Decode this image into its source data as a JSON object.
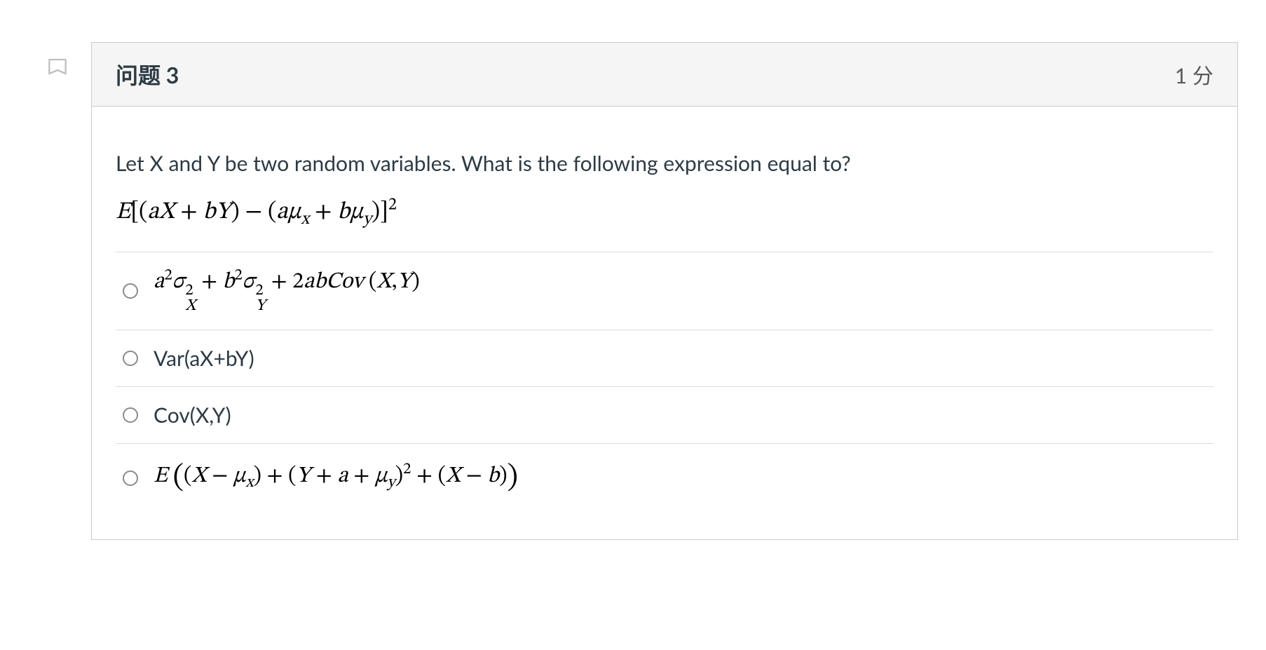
{
  "question": {
    "title": "问题 3",
    "points": "1 分",
    "prompt": "Let X and Y be two random variables. What is the following expression equal to?",
    "expression_html": "<span class='m'>E</span><span class='rm'>[(</span><span class='m'>aX</span> <span class='rm'>+</span> <span class='m'>bY</span><span class='rm'>)</span> <span class='rm'>−</span> <span class='rm'>(</span><span class='m'>aμ</span><sub class='m'>x</sub> <span class='rm'>+</span> <span class='m'>bμ</span><sub class='m'>y</sub><span class='rm'>)]</span><sup>2</sup>",
    "answers": [
      {
        "id": "a",
        "is_math": true,
        "html": "<span class='m'>a</span><sup>2</sup><span class='m'>σ</span><span class='subsup'><span class='sup'>2</span><span class='sub m'>X</span></span> <span class='rm'>+</span> <span class='m'>b</span><sup>2</sup><span class='m'>σ</span><span class='subsup'><span class='sup'>2</span><span class='sub m'>Y</span></span> <span class='rm'>+</span> <span class='rm'>2</span><span class='m'>abCov</span> <span class='rm'>(</span><span class='m'>X</span><span class='rm'>,</span><span class='m'>Y</span><span class='rm'>)</span>"
      },
      {
        "id": "b",
        "is_math": false,
        "html": "Var(aX+bY)"
      },
      {
        "id": "c",
        "is_math": false,
        "html": "Cov(X,Y)"
      },
      {
        "id": "d",
        "is_math": true,
        "html": "<span class='m'>E</span> <span class='big-open'>(</span><span class='rm'>(</span><span class='m'>X</span> <span class='rm'>−</span> <span class='m'>μ</span><sub class='m'>x</sub><span class='rm'>)</span> <span class='rm'>+</span> <span class='rm'>(</span><span class='m'>Y</span> <span class='rm'>+</span> <span class='m'>a</span> <span class='rm'>+</span> <span class='m'>μ</span><sub class='m'>y</sub><span class='rm'>)</span><sup>2</sup> <span class='rm'>+</span> <span class='rm'>(</span><span class='m'>X</span> <span class='rm'>−</span> <span class='m'>b</span><span class='rm'>)</span><span class='big-close'>)</span>"
      }
    ]
  }
}
